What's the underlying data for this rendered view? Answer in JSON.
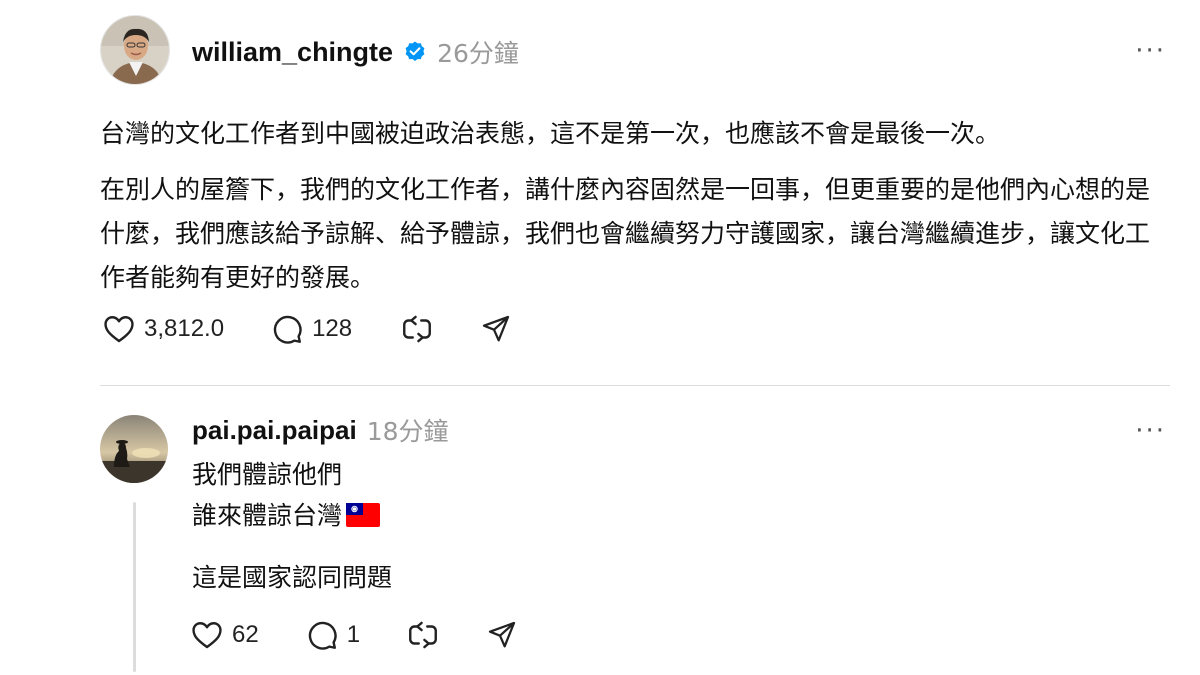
{
  "post": {
    "username": "william_chingte",
    "time": "26分鐘",
    "more_label": "···",
    "paragraphs": [
      "台灣的文化工作者到中國被迫政治表態，這不是第一次，也應該不會是最後一次。",
      "在別人的屋簷下，我們的文化工作者，講什麼內容固然是一回事，但更重要的是他們內心想的是什麼，我們應該給予諒解、給予體諒，我們也會繼續努力守護國家，讓台灣繼續進步，讓文化工作者能夠有更好的發展。"
    ],
    "likes": "3,812.0",
    "comments": "128"
  },
  "reply": {
    "username": "pai.pai.paipai",
    "time": "18分鐘",
    "more_label": "···",
    "lines": [
      "我們體諒他們",
      "誰來體諒台灣",
      "這是國家認同問題"
    ],
    "likes": "62",
    "comments": "1"
  },
  "colors": {
    "verified_blue": "#0095f6",
    "muted_gray": "#9a9a9a",
    "divider": "#dcdcdc",
    "flag_red": "#fe0000",
    "flag_blue": "#000095"
  },
  "icons": [
    "verified-badge-icon",
    "heart-icon",
    "comment-icon",
    "repost-icon",
    "share-icon",
    "more-icon",
    "taiwan-flag-icon"
  ]
}
